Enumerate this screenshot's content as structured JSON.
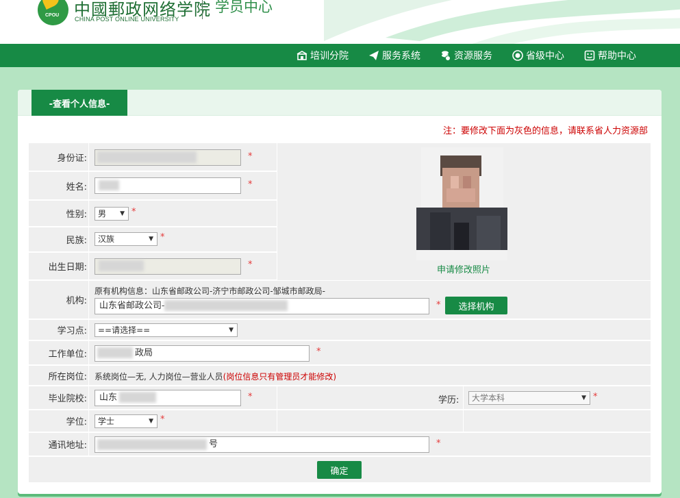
{
  "header": {
    "org_name": "中國郵政网络学院",
    "org_sub": "CHINA POST ONLINE UNIVERSITY",
    "logo_text": "CPOU",
    "site_title": "学员中心"
  },
  "nav": [
    {
      "label": "培训分院",
      "icon": "building-icon"
    },
    {
      "label": "服务系统",
      "icon": "paper-plane-icon"
    },
    {
      "label": "资源服务",
      "icon": "coins-icon"
    },
    {
      "label": "省级中心",
      "icon": "target-icon"
    },
    {
      "label": "帮助中心",
      "icon": "smiley-box-icon"
    }
  ],
  "panel": {
    "tab": "-查看个人信息-",
    "notice": "注：要修改下面为灰色的信息，请联系省人力资源部"
  },
  "form": {
    "id_card": {
      "label": "身份证:",
      "value": ""
    },
    "name": {
      "label": "姓名:",
      "value": ""
    },
    "gender": {
      "label": "性别:",
      "value": "男"
    },
    "ethnicity": {
      "label": "民族:",
      "value": "汉族"
    },
    "birth_date": {
      "label": "出生日期:",
      "value": ""
    },
    "org": {
      "label": "机构:",
      "original": "原有机构信息：山东省邮政公司-济宁市邮政公司-邹城市邮政局-",
      "value": "山东省邮政公司-",
      "button": "选择机构"
    },
    "study_point": {
      "label": "学习点:",
      "value": "==请选择=="
    },
    "work_unit": {
      "label": "工作单位:",
      "value": "政局"
    },
    "position": {
      "label": "所在岗位:",
      "value": "系统岗位—无, 人力岗位—营业人员",
      "note": "(岗位信息只有管理员才能修改)"
    },
    "school": {
      "label": "毕业院校:",
      "value": "山东"
    },
    "education": {
      "label": "学历:",
      "value": "大学本科"
    },
    "degree": {
      "label": "学位:",
      "value": "学士"
    },
    "address": {
      "label": "通讯地址:",
      "value": "号"
    },
    "required_mark": "*",
    "submit": "确定"
  },
  "photo": {
    "link": "申请修改照片"
  },
  "colors": {
    "brand_green": "#178a45",
    "bg_green": "#b5e4c2",
    "required_red": "#e53a3a",
    "notice_red": "#cc0000"
  }
}
